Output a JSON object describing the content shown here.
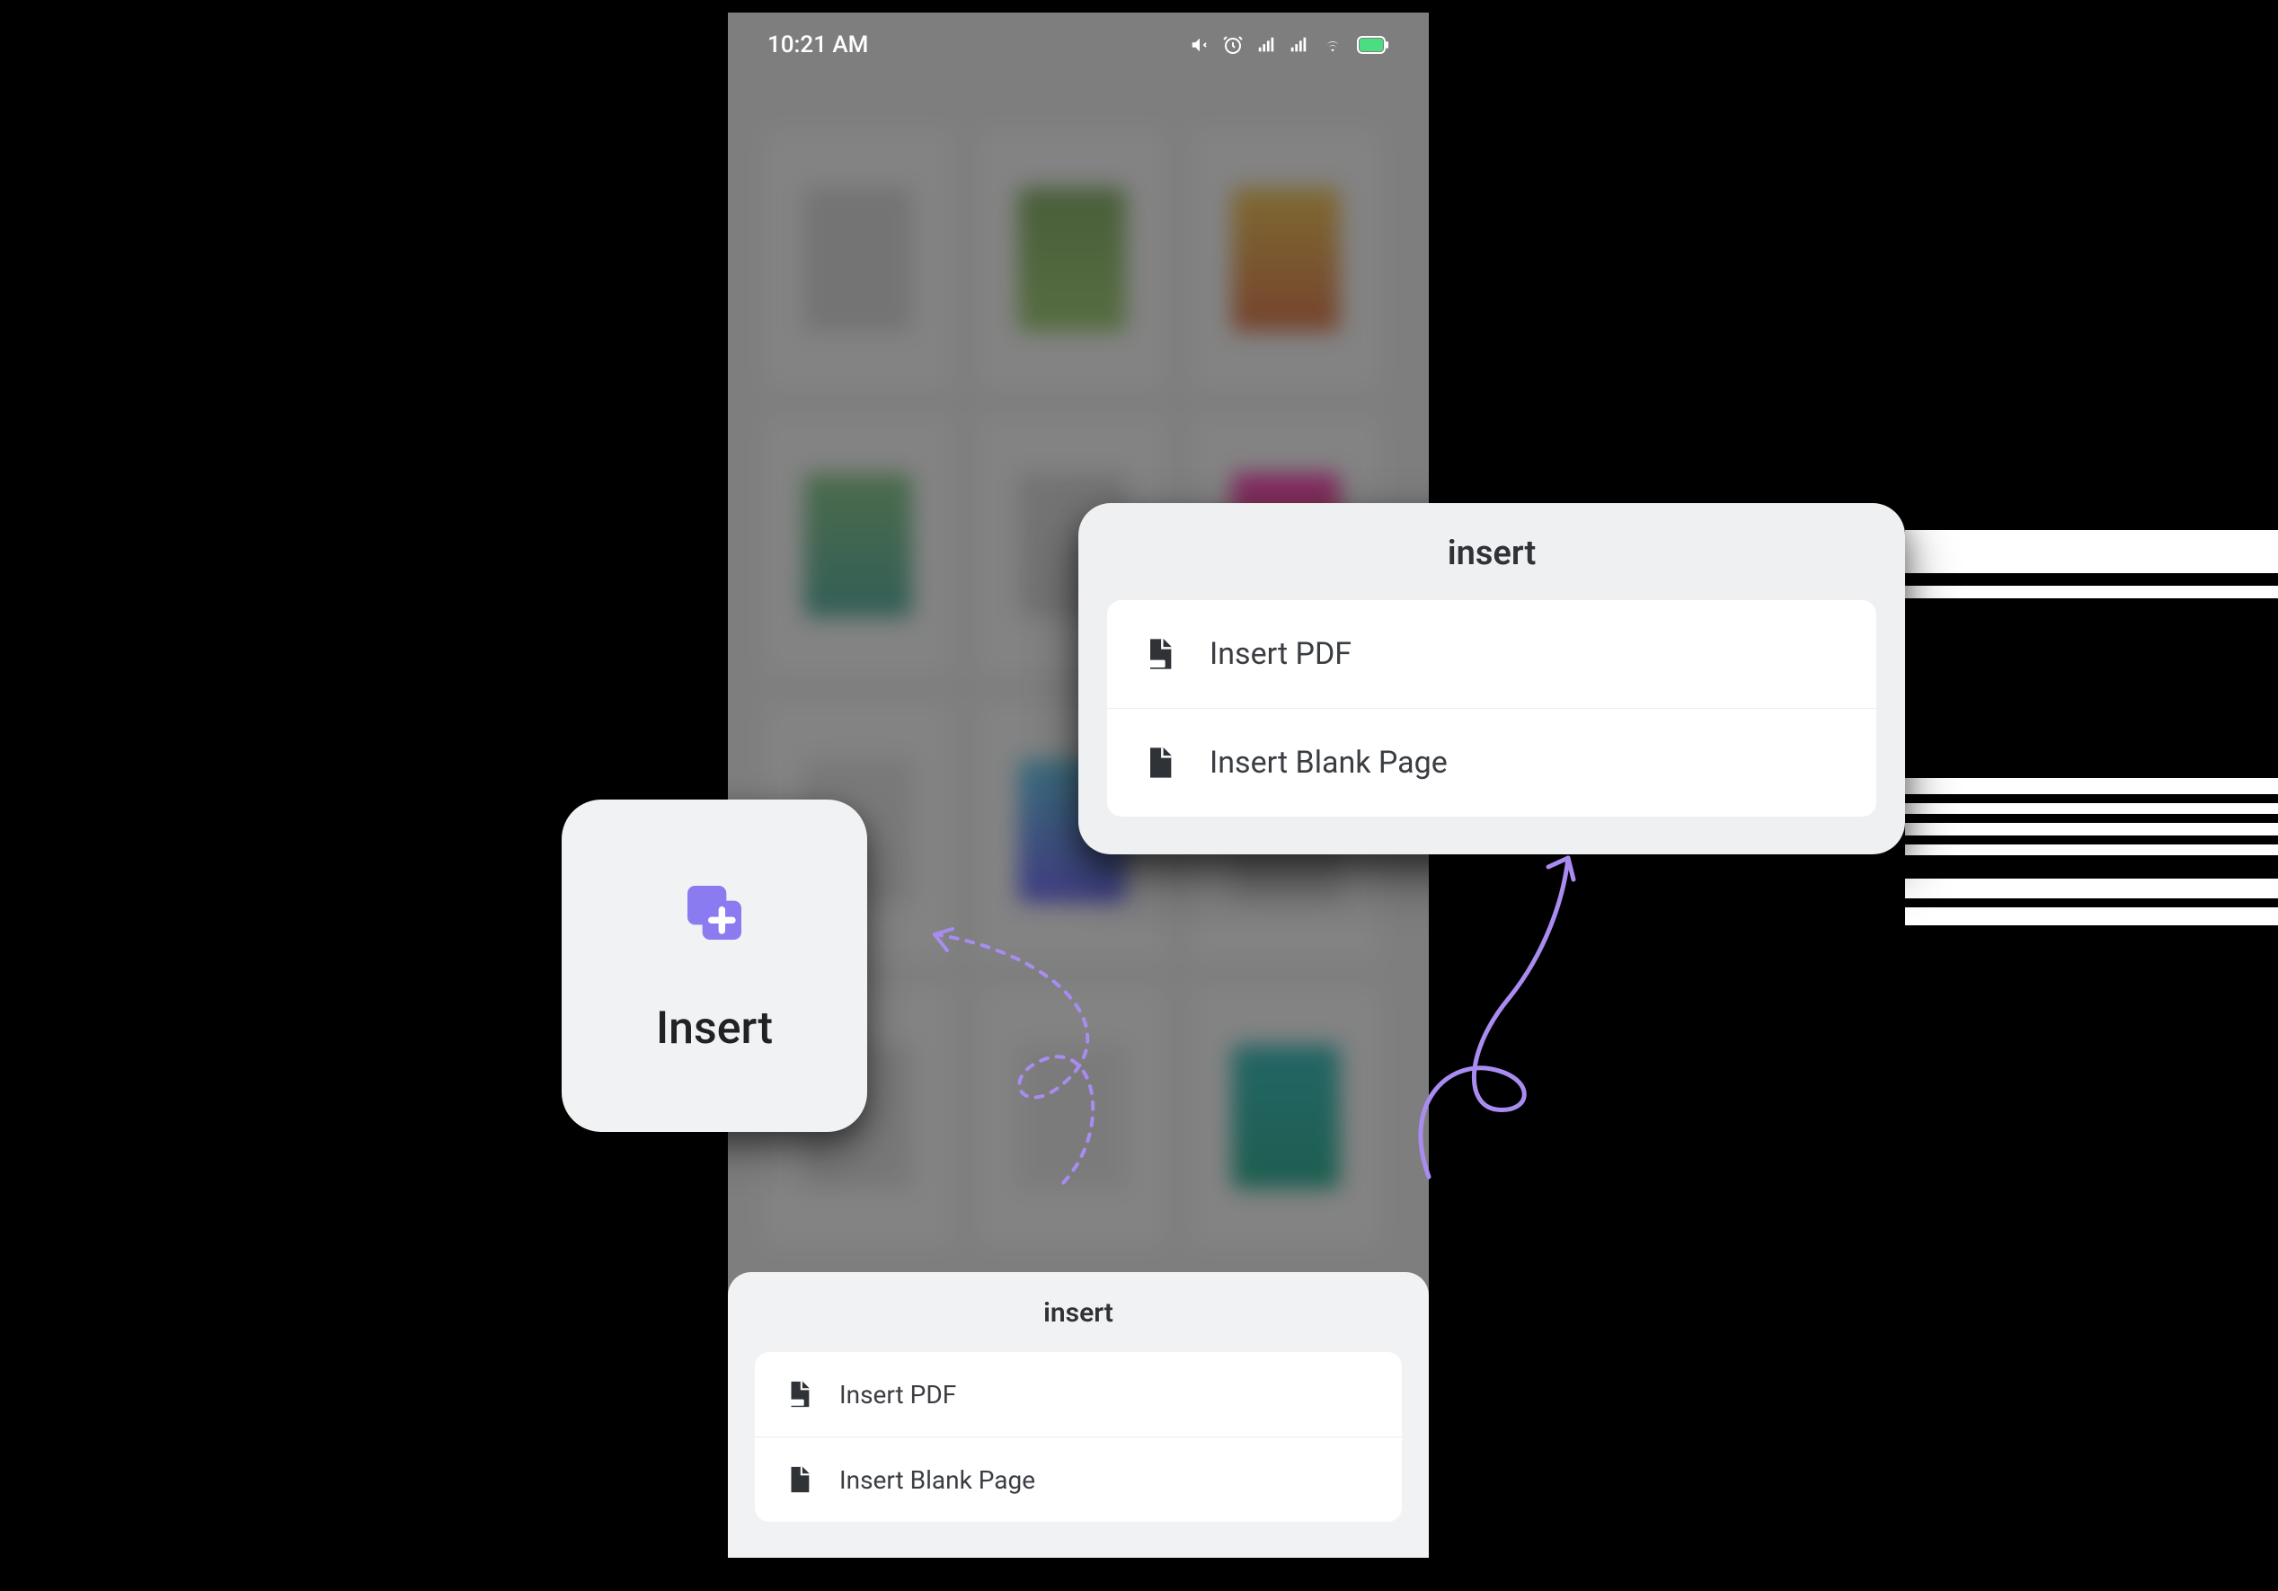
{
  "status_bar": {
    "time": "10:21 AM"
  },
  "insert_card": {
    "label": "Insert"
  },
  "sheet": {
    "title": "insert",
    "options": [
      {
        "label": "Insert PDF"
      },
      {
        "label": "Insert Blank Page"
      }
    ]
  },
  "popup": {
    "title": "insert",
    "options": [
      {
        "label": "Insert PDF"
      },
      {
        "label": "Insert Blank Page"
      }
    ]
  },
  "colors": {
    "accent": "#8a7cf0",
    "arrow": "#a88cf0"
  }
}
